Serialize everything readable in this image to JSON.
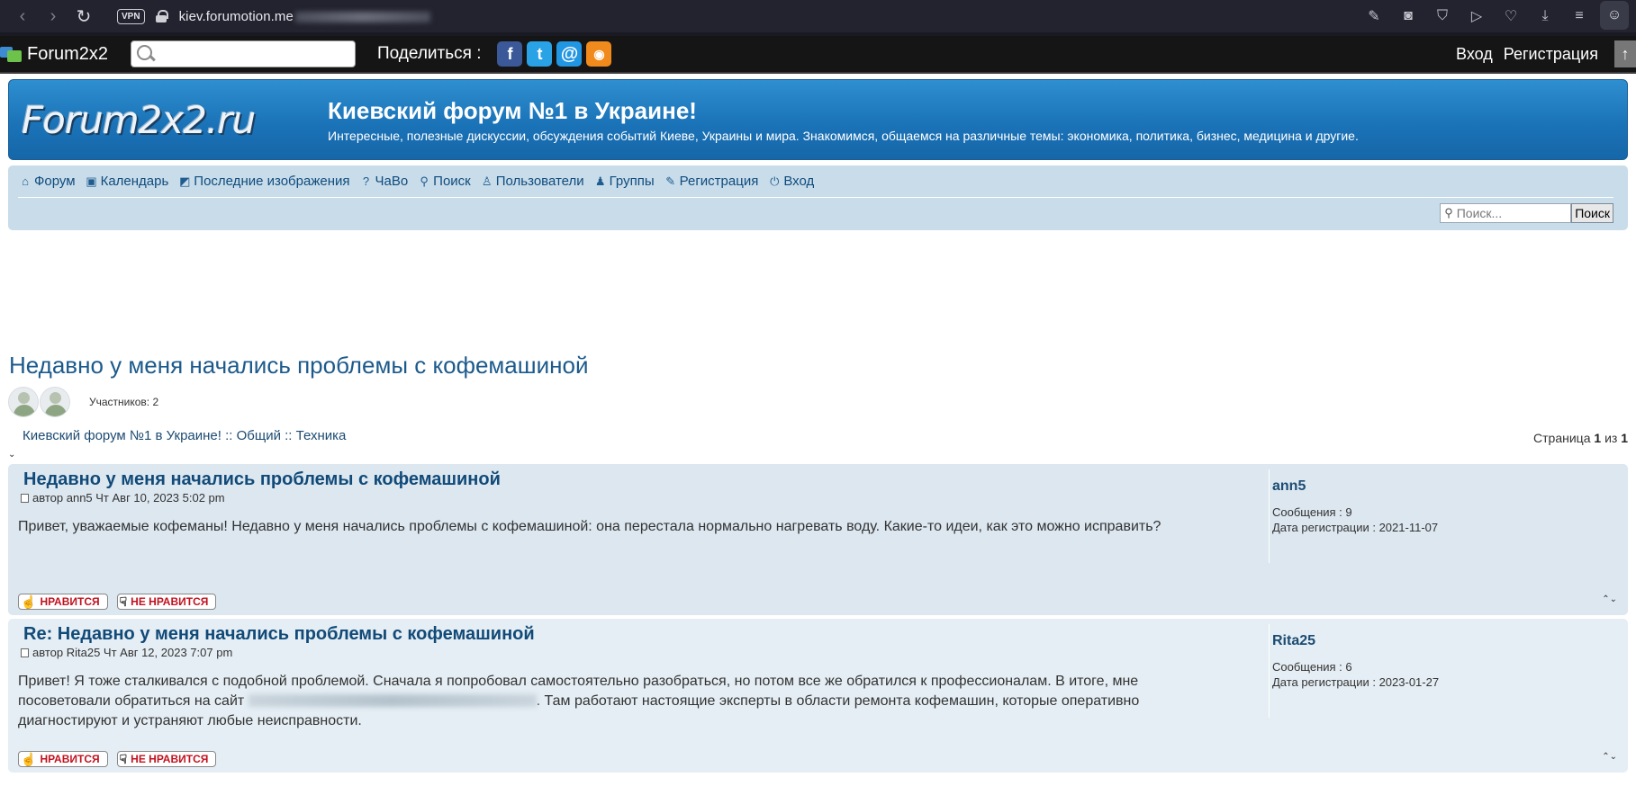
{
  "browser": {
    "url_domain": "kiev.forumotion.me",
    "vpn_label": "VPN"
  },
  "toolbar": {
    "logo_text": "Forum2x2",
    "share_label": "Поделиться :",
    "login_label": "Вход",
    "register_label": "Регистрация"
  },
  "banner": {
    "logo_text": "Forum2x2.ru",
    "title": "Киевский форум №1 в Украине!",
    "subtitle": "Интересные, полезные дискуссии, обсуждения событий Киеве, Украины и мира. Знакомимся, общаемся на различные темы: экономика, политика, бизнес, медицина и другие."
  },
  "nav": {
    "items": [
      {
        "label": "Форум",
        "icon": "home-icon"
      },
      {
        "label": "Календарь",
        "icon": "calendar-icon"
      },
      {
        "label": "Последние изображения",
        "icon": "image-icon"
      },
      {
        "label": "ЧаВо",
        "icon": "help-icon"
      },
      {
        "label": "Поиск",
        "icon": "search-icon"
      },
      {
        "label": "Пользователи",
        "icon": "user-icon"
      },
      {
        "label": "Группы",
        "icon": "group-icon"
      },
      {
        "label": "Регистрация",
        "icon": "register-icon"
      },
      {
        "label": "Вход",
        "icon": "power-icon"
      }
    ],
    "search_placeholder": "Поиск...",
    "search_button": "Поиск"
  },
  "topic": {
    "title": "Недавно у меня начались проблемы с кофемашиной",
    "participants_label": "Участников: 2",
    "breadcrumb": "Киевский форум №1 в Украине! :: Общий :: Техника",
    "pager_prefix": "Страница",
    "page_current": "1",
    "pager_of": "из",
    "page_total": "1"
  },
  "posts": [
    {
      "title": "Недавно у меня начались проблемы с кофемашиной",
      "meta": "автор ann5 Чт Авг 10, 2023 5:02 pm",
      "text": "Привет, уважаемые кофеманы! Недавно у меня начались проблемы с кофемашиной: она перестала нормально нагревать воду. Какие-то идеи, как это можно исправить?",
      "author": "ann5",
      "messages": "Сообщения : 9",
      "registered": "Дата регистрации : 2021-11-07"
    },
    {
      "title": "Re: Недавно у меня начались проблемы с кофемашиной",
      "meta": "автор Rita25 Чт Авг 12, 2023 7:07 pm",
      "text_before": "Привет! Я тоже сталкивался с подобной проблемой. Сначала я попробовал самостоятельно разобраться, но потом все же обратился к профессионалам. В итоге, мне посоветовали обратиться на сайт",
      "text_after": ". Там работают настоящие эксперты в области ремонта кофемашин, которые оперативно диагностируют и устраняют любые неисправности.",
      "author": "Rita25",
      "messages": "Сообщения : 6",
      "registered": "Дата регистрации : 2023-01-27"
    }
  ],
  "reactions": {
    "like": "НРАВИТСЯ",
    "dislike": "НЕ НРАВИТСЯ"
  },
  "colors": {
    "banner": "#1b73b8",
    "navbar": "#c9dcea",
    "post_bg": "#dce7f0",
    "link": "#114a78",
    "reaction_text": "#c1121f"
  }
}
